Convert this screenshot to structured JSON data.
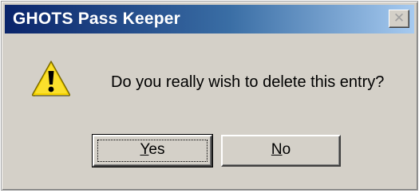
{
  "window": {
    "title": "GHOTS Pass Keeper",
    "close_glyph": "✕"
  },
  "dialog": {
    "icon": "warning-icon",
    "message": "Do you really wish to delete this entry?",
    "buttons": {
      "yes": {
        "mnemonic": "Y",
        "rest": "es",
        "label": "Yes"
      },
      "no": {
        "mnemonic": "N",
        "rest": "o",
        "label": "No"
      }
    }
  },
  "colors": {
    "titlebar_start": "#0a246a",
    "titlebar_end": "#a6caf0",
    "dialog_face": "#d4d0c8",
    "warning_yellow": "#f5d300"
  }
}
